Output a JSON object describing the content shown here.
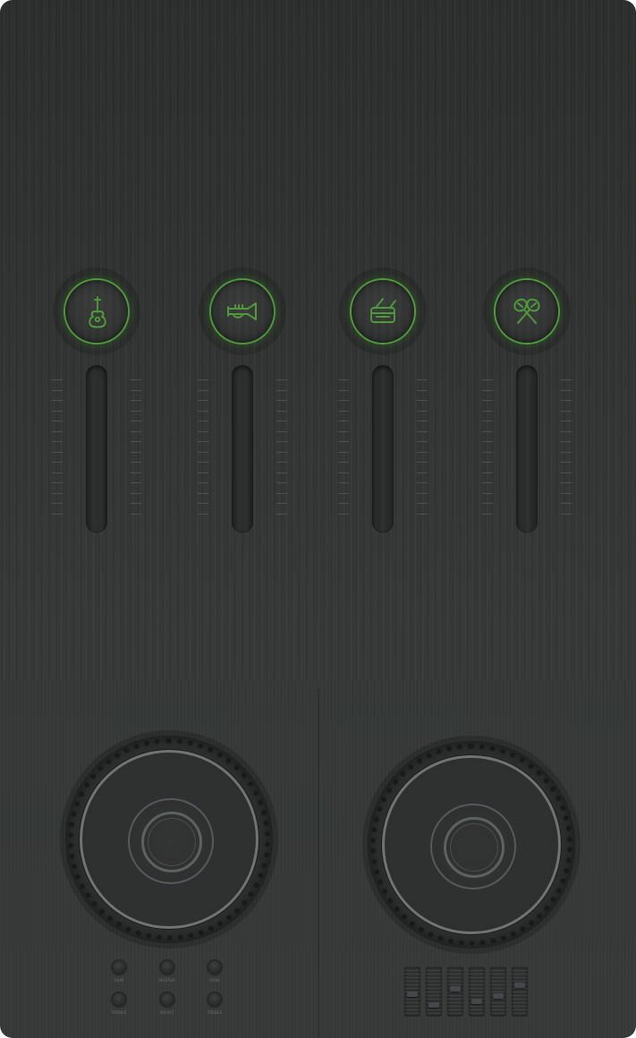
{
  "mixer": {
    "channels": [
      {
        "id": "guitar",
        "icon": "guitar-icon"
      },
      {
        "id": "trumpet",
        "icon": "trumpet-icon"
      },
      {
        "id": "drum",
        "icon": "drum-icon"
      },
      {
        "id": "maracas",
        "icon": "maracas-icon"
      }
    ],
    "accent_color": "#4e9a3a"
  },
  "decks": [
    {
      "id": "left-deck"
    },
    {
      "id": "right-deck"
    }
  ],
  "knobs": {
    "row1": [
      {
        "label": "GAIN"
      },
      {
        "label": "MASTER"
      },
      {
        "label": "GAIN"
      }
    ],
    "row2": [
      {
        "label": "TREBLE"
      },
      {
        "label": "BOOST"
      },
      {
        "label": "TREBLE"
      }
    ]
  }
}
